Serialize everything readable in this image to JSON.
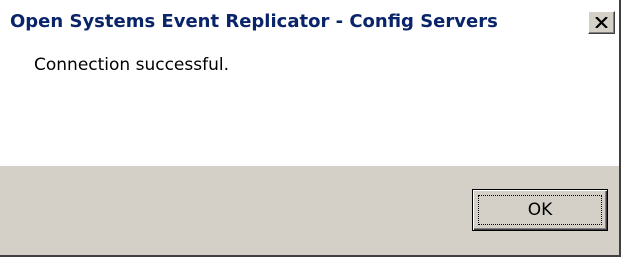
{
  "window": {
    "title": "Open Systems Event Replicator - Config Servers",
    "close_icon": "close-icon"
  },
  "message": {
    "text": "Connection successful."
  },
  "buttons": {
    "ok_label": "OK"
  },
  "colors": {
    "title_text": "#0a246a",
    "button_face": "#d4d0c8",
    "content_bg": "#ffffff"
  }
}
